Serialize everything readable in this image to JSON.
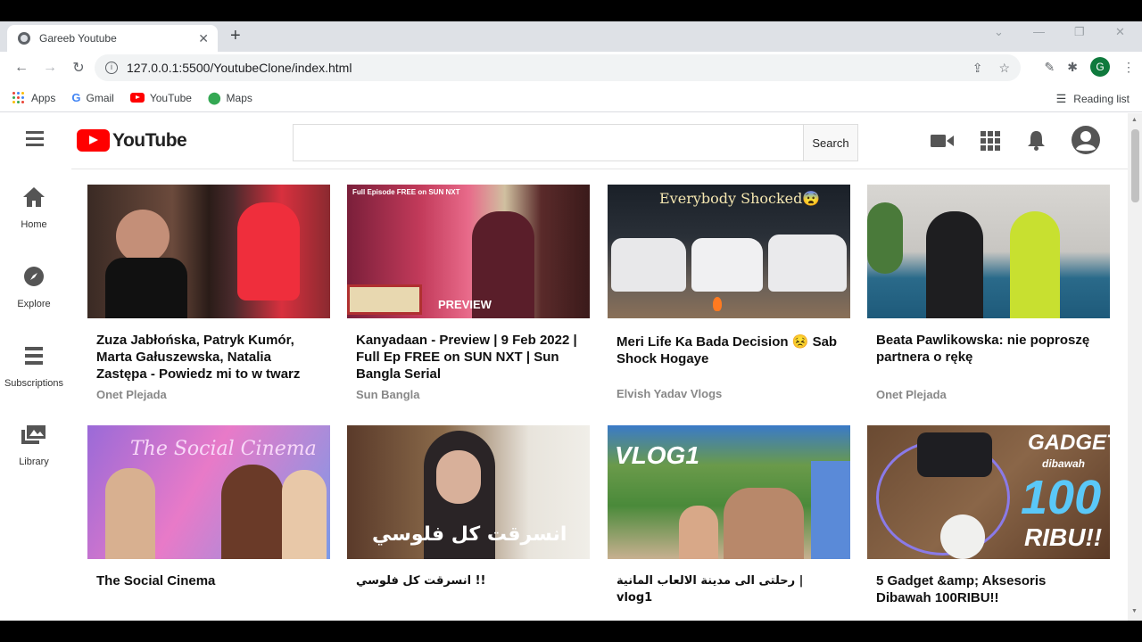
{
  "browser": {
    "tab_title": "Gareeb Youtube",
    "url": "127.0.0.1:5500/YoutubeClone/index.html",
    "profile_initial": "G",
    "bookmarks": [
      {
        "label": "Apps",
        "icon": "apps-grid-icon"
      },
      {
        "label": "Gmail",
        "icon": "google-icon"
      },
      {
        "label": "YouTube",
        "icon": "youtube-icon"
      },
      {
        "label": "Maps",
        "icon": "maps-pin-icon"
      }
    ],
    "reading_list": "Reading list"
  },
  "header": {
    "logo_text": "YouTube",
    "search_placeholder": "",
    "search_button": "Search"
  },
  "sidebar": {
    "items": [
      {
        "label": "Home",
        "icon": "home-icon"
      },
      {
        "label": "Explore",
        "icon": "compass-icon"
      },
      {
        "label": "Subscriptions",
        "icon": "subscriptions-icon"
      },
      {
        "label": "Library",
        "icon": "library-icon"
      }
    ]
  },
  "videos": [
    {
      "title": "Zuza Jabłońska, Patryk Kumór, Marta Gałuszewska, Natalia Zastępa - Powiedz mi to w twarz",
      "channel": "Onet Plejada"
    },
    {
      "title": "Kanyadaan - Preview | 9 Feb 2022 | Full Ep FREE on SUN NXT | Sun Bangla Serial",
      "channel": "Sun Bangla",
      "thumb_top": "Full Episode FREE on SUN NXT",
      "thumb_badge": "PREVIEW"
    },
    {
      "title": "Meri Life Ka Bada Decision 😣 Sab Shock Hogaye",
      "channel": "Elvish Yadav Vlogs",
      "thumb_text": "Everybody Shocked😨"
    },
    {
      "title": "Beata Pawlikowska: nie poproszę partnera o rękę",
      "channel": "Onet Plejada"
    },
    {
      "title": "The Social Cinema",
      "channel": "",
      "thumb_text": "The Social Cinema"
    },
    {
      "title": "انسرقت كل فلوسي !!",
      "channel": "",
      "thumb_text": "انسرقت كل فلوسي"
    },
    {
      "title": "رحلتى الى مدينة الالعاب المانية | vlog1",
      "channel": "",
      "thumb_text": "VLOG1"
    },
    {
      "title": "5 Gadget &amp; Aksesoris Dibawah 100RIBU!!",
      "channel": "",
      "thumb_text_1": "GADGET",
      "thumb_text_2": "dibawah",
      "thumb_text_3": "100",
      "thumb_text_4": "RIBU!!"
    }
  ]
}
